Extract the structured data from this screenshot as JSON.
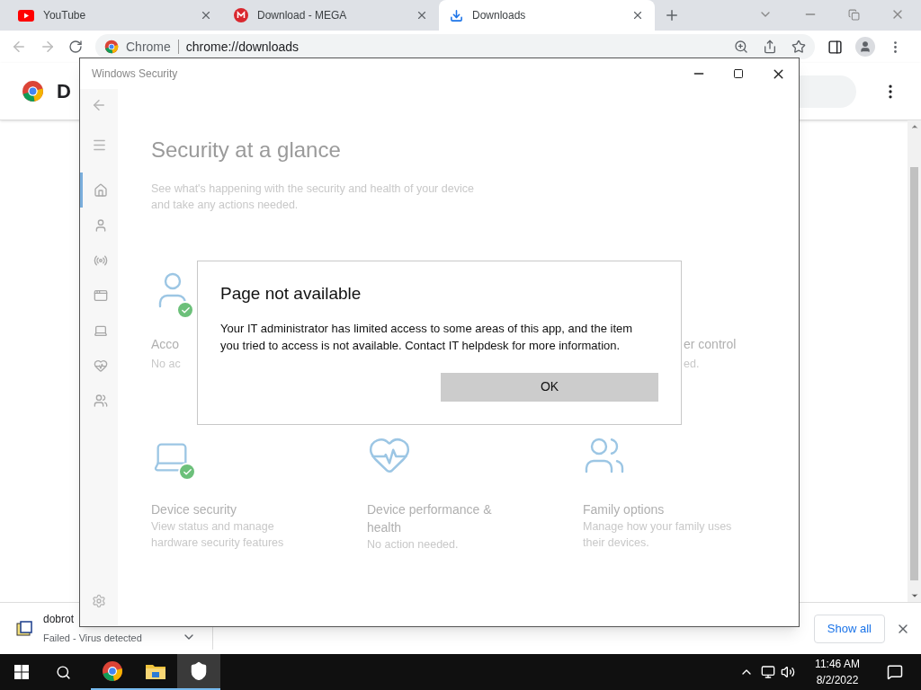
{
  "browser": {
    "tabs": [
      {
        "title": "YouTube",
        "selected": false
      },
      {
        "title": "Download - MEGA",
        "selected": false
      },
      {
        "title": "Downloads",
        "selected": true
      }
    ],
    "omnibox": {
      "chip": "Chrome",
      "url": "chrome://downloads"
    },
    "page_heading": "D",
    "download": {
      "filename": "dobrot",
      "status": "Failed - Virus detected"
    },
    "show_all": "Show all"
  },
  "security_window": {
    "title": "Windows Security",
    "heading": "Security at a glance",
    "subtitle": "See what's happening with the security and health of your device and take any actions needed.",
    "nav": [
      {
        "selected": true
      },
      {
        "selected": false
      },
      {
        "selected": false
      },
      {
        "selected": false
      },
      {
        "selected": false
      },
      {
        "selected": false
      },
      {
        "selected": false
      }
    ],
    "cards_top": [
      {
        "title": "Acco",
        "description": "No ac"
      },
      {
        "title": "er control",
        "description": "ed."
      }
    ],
    "cards_bottom": [
      {
        "title": "Device security",
        "description": "View status and manage hardware security features"
      },
      {
        "title": "Device performance & health",
        "description": "No action needed."
      },
      {
        "title": "Family options",
        "description": "Manage how your family uses their devices."
      }
    ]
  },
  "dialog": {
    "title": "Page not available",
    "message": "Your IT administrator has limited access to some areas of this app, and the item you tried to access is not available. Contact IT helpdesk for more information.",
    "button": "OK"
  },
  "taskbar": {
    "apps": [
      {
        "selected": false
      },
      {
        "selected": false
      },
      {
        "selected": true
      }
    ],
    "time": "11:46 AM",
    "date": "8/2/2022"
  }
}
